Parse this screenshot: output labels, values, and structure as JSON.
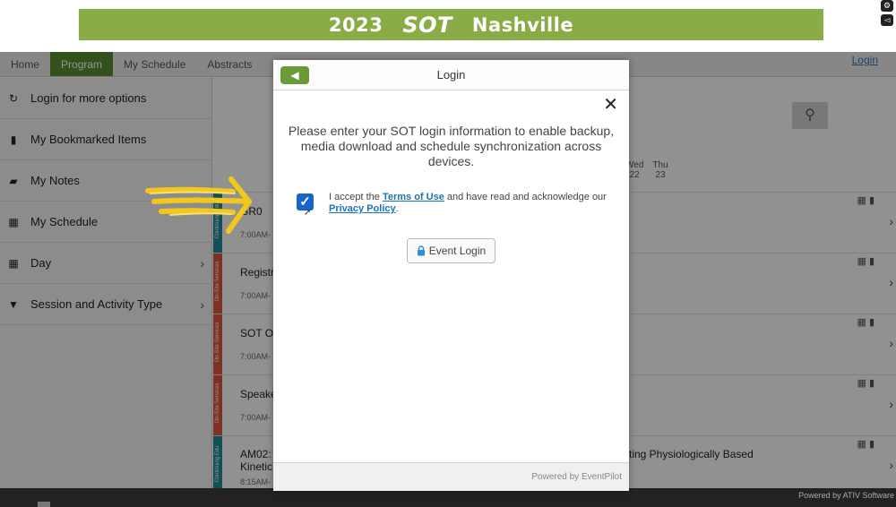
{
  "banner": {
    "year": "2023",
    "logo_text": "SOT",
    "city": "Nashville",
    "color": "#8aac46"
  },
  "nav": {
    "tabs": [
      {
        "label": "Home",
        "active": false
      },
      {
        "label": "Program",
        "active": true
      },
      {
        "label": "My Schedule",
        "active": false
      },
      {
        "label": "Abstracts",
        "active": false
      }
    ],
    "login_link": "Login"
  },
  "sidebar": {
    "items": [
      {
        "label": "Login for more options",
        "icon": "refresh-icon"
      },
      {
        "label": "My Bookmarked Items",
        "icon": "bookmark-icon"
      },
      {
        "label": "My Notes",
        "icon": "note-icon"
      },
      {
        "label": "My Schedule",
        "icon": "calendar-icon"
      },
      {
        "label": "Day",
        "icon": "calendar-icon",
        "chevron": true
      },
      {
        "label": "Session and Activity Type",
        "icon": "filter-icon",
        "chevron": true
      }
    ]
  },
  "days": [
    {
      "name": "Wed",
      "num": "22"
    },
    {
      "name": "Thu",
      "num": "23"
    }
  ],
  "sessions": [
    {
      "title": "GR0",
      "time": "7:00AM-",
      "tag": "Continuing Edu",
      "color": "#1f8a9a"
    },
    {
      "title": "Registr",
      "time": "7:00AM-",
      "tag": "On-Site Services",
      "color": "#d9533b"
    },
    {
      "title": "SOT O",
      "time": "7:00AM-",
      "tag": "On-Site Services",
      "color": "#d9533b"
    },
    {
      "title": "Speake",
      "time": "7:00AM-",
      "tag": "On-Site Services",
      "color": "#d9533b"
    },
    {
      "title": "AM02:",
      "title2": "Kinetic",
      "title_end": "ting Physiologically Based",
      "time": "8:15AM-",
      "tag": "Continuing Edu",
      "color": "#1f8a9a"
    }
  ],
  "modal": {
    "title": "Login",
    "message": "Please enter your SOT login information to enable backup, media download and schedule synchronization across devices.",
    "accept_prefix": "I accept the",
    "terms_link": "Terms of Use",
    "accept_middle": "and have read and acknowledge our",
    "privacy_link": "Privacy Policy",
    "accept_suffix": ".",
    "checkbox_checked": true,
    "event_login_label": "Event Login",
    "footer": "Powered by EventPilot",
    "accent": "#6b9a38",
    "checkbox_color": "#1a64c8"
  },
  "footer": {
    "powered": "Powered by ATIV Software"
  },
  "annotation": {
    "arrow_color": "#f2c81c"
  }
}
